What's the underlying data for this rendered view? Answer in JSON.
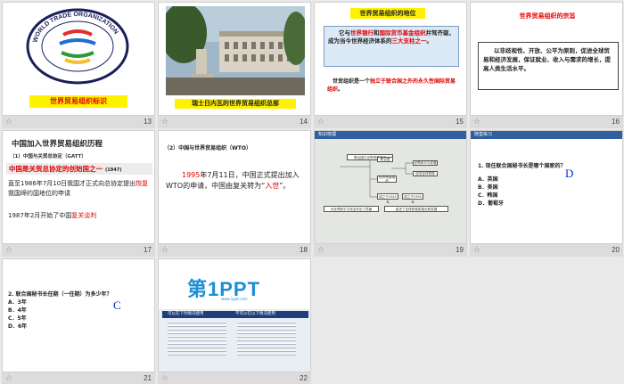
{
  "slides": [
    {
      "num": "13",
      "caption": "世界贸易组织标识",
      "logo_text": "WORLD TRADE ORGANIZATION"
    },
    {
      "num": "14",
      "caption": "瑞士日内瓦的世界贸易组织总部"
    },
    {
      "num": "15",
      "title": "世界贸易组织的地位",
      "p1_a": "它与",
      "p1_b": "世界银行",
      "p1_c": "和",
      "p1_d": "国际货币基金组织",
      "p1_e": "并驾齐驱，成为当今世界经济体系的",
      "p1_f": "三大支柱之一",
      "p1_g": "。",
      "p2_a": "世贸组织是一个",
      "p2_b": "独立于联合国之外的永久性国际贸易组织",
      "p2_c": "。"
    },
    {
      "num": "16",
      "title": "世界贸易组织的宗旨",
      "body": "以非歧视性、开放、公平为原则，促进全球贸易和经济发展，保证就业、收入与需求的增长，提高人类生活水平。"
    },
    {
      "num": "17",
      "title": "中国加入世界贸易组织历程",
      "sub": "（1）中国与关贸总协定（GATT）",
      "line1": "中国是关贸总协定的创始国之一",
      "line1_tag": "(1947)",
      "line2": "直至1986年7月10日我国才正式向总协定提出",
      "line2_red": "恢复",
      "line2_b": "我国缔约国地位的申请",
      "line3_a": "1987年2月开始了中国",
      "line3_b": "复关谈判"
    },
    {
      "num": "18",
      "sub": "（2）中国与世界贸易组织（WTO）",
      "b_a": "1995",
      "b_b": "年7月11日，中国正式提出加入WTO的申请，中国由复关转为“",
      "b_c": "入世",
      "b_d": "”。"
    },
    {
      "num": "19",
      "header": "知识梳理",
      "boxes": [
        "联合国与世界贸易组织",
        "联合国",
        "世界贸易组织",
        "世界和平与发展",
        "促进全球贸易",
        "成立于1945年",
        "成立于1995年",
        "为世界和平与安全作出了贡献",
        "促进了全球贸易的增长和发展"
      ]
    },
    {
      "num": "20",
      "header": "随堂练习",
      "q": "1. 现任联合国秘书长是哪个国家的？",
      "answer": "D",
      "options": [
        "A．英国",
        "B．美国",
        "C．韩国",
        "D．葡萄牙"
      ]
    },
    {
      "num": "21",
      "q": "2. 联合国秘书长任期（一任期）为多少年？",
      "answer": "C",
      "options": [
        "A．3年",
        "B．4年",
        "C．5年",
        "D．6年"
      ]
    },
    {
      "num": "22",
      "brand": "第1PPT",
      "brand_sub": "www.1ppt.com",
      "link_left": "可以在下列情况使用",
      "link_right": "不可以在以下情况使用"
    }
  ],
  "colors": {
    "accent_red": "#e00000",
    "highlight_yellow": "#fff200",
    "title_blue": "#0033cc"
  }
}
